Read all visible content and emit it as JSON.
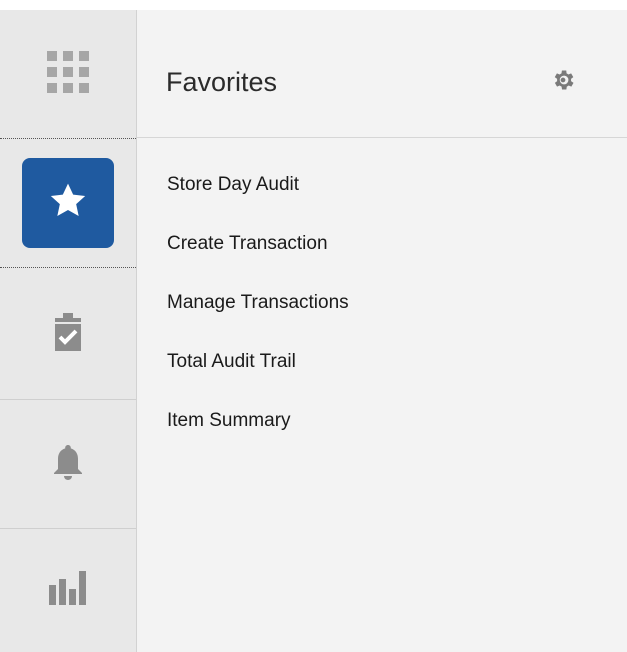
{
  "rail": {
    "items": [
      {
        "icon": "apps-grid-icon",
        "active": false
      },
      {
        "icon": "star-icon",
        "active": true
      },
      {
        "icon": "clipboard-check-icon",
        "active": false
      },
      {
        "icon": "bell-icon",
        "active": false
      },
      {
        "icon": "bar-chart-icon",
        "active": false
      }
    ],
    "active_color": "#1f5aa0",
    "icon_color": "#8c8c8c"
  },
  "panel": {
    "title": "Favorites",
    "settings_icon": "gear-icon",
    "items": [
      {
        "label": "Store Day Audit"
      },
      {
        "label": "Create Transaction"
      },
      {
        "label": "Manage Transactions"
      },
      {
        "label": "Total Audit Trail"
      },
      {
        "label": "Item Summary"
      }
    ]
  }
}
